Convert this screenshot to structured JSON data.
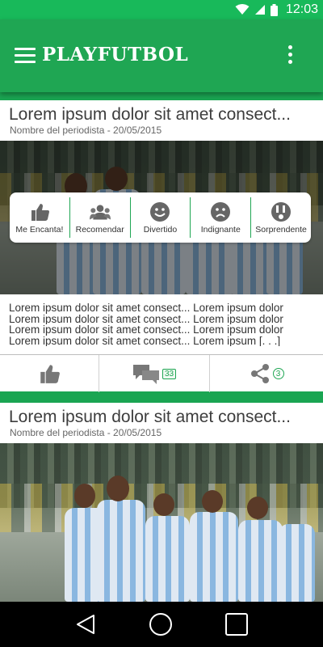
{
  "status_bar": {
    "time": "12:03"
  },
  "app_bar": {
    "title": "PLAYFUTBOL"
  },
  "colors": {
    "primary": "#1fa653",
    "status": "#18b95a",
    "accent_badge": "#1fa653"
  },
  "feed": [
    {
      "title": "Lorem ipsum dolor sit amet consect...",
      "meta": "Nombre del periodista - 20/05/2015",
      "reactions": [
        {
          "label": "Me Encanta!",
          "icon": "thumbs-up-icon"
        },
        {
          "label": "Recomendar",
          "icon": "people-icon"
        },
        {
          "label": "Divertido",
          "icon": "smile-icon"
        },
        {
          "label": "Indignante",
          "icon": "frown-icon"
        },
        {
          "label": "Sorprendente",
          "icon": "surprise-icon"
        }
      ],
      "body_lines": [
        "Lorem ipsum dolor sit amet consect... Lorem ipsum dolor",
        "Lorem ipsum dolor sit amet consect... Lorem ipsum dolor",
        "Lorem ipsum dolor sit amet consect... Lorem ipsum dolor",
        "Lorem ipsum dolor sit amet consect... Lorem ipsum [. . .]"
      ],
      "actions": {
        "like_icon": "thumbs-up-icon",
        "comments_count": "33",
        "shares_count": "3"
      }
    },
    {
      "title": "Lorem ipsum dolor sit amet consect...",
      "meta": "Nombre del periodista - 20/05/2015"
    }
  ],
  "nav": {
    "back_icon": "back-triangle-icon",
    "home_icon": "home-circle-icon",
    "recents_icon": "recents-square-icon"
  }
}
